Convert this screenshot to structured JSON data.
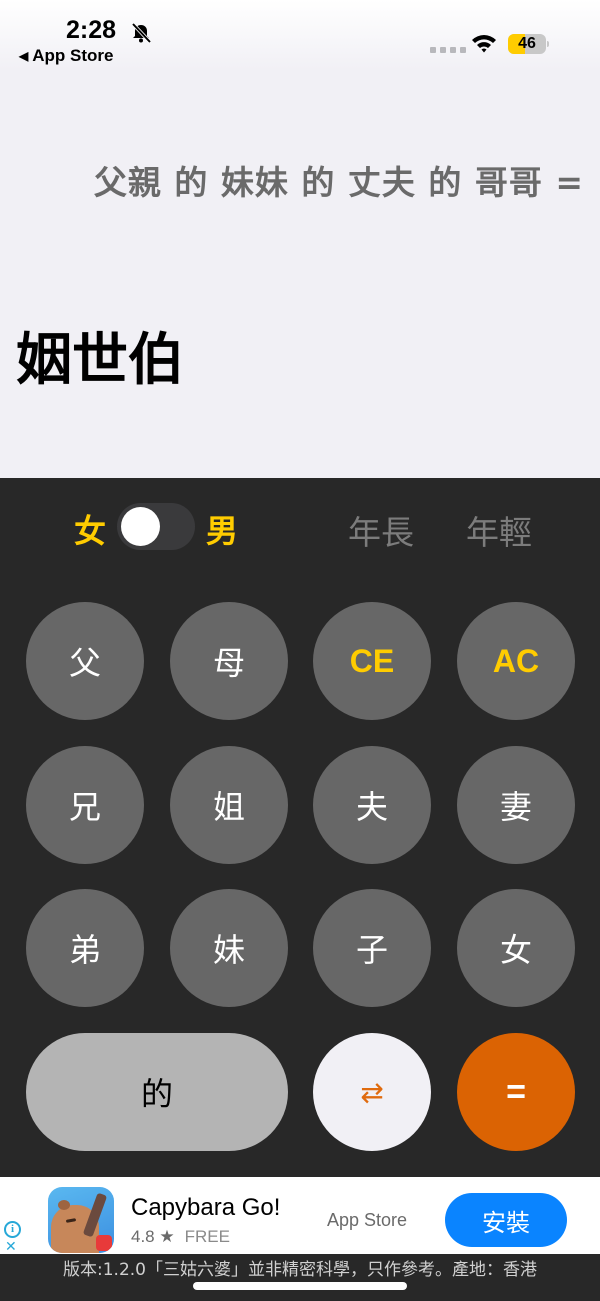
{
  "status_bar": {
    "time": "2:28",
    "back_label": "App Store",
    "battery_level": "46",
    "battery_percent": 46
  },
  "display": {
    "expression": "父親 的 妹妹 的 丈夫 的 哥哥 =",
    "result": "姻世伯"
  },
  "controls": {
    "gender_female": "女",
    "gender_male": "男",
    "age_older": "年長",
    "age_younger": "年輕"
  },
  "keys": {
    "father": "父",
    "mother": "母",
    "ce": "CE",
    "ac": "AC",
    "elder_brother": "兄",
    "elder_sister": "姐",
    "husband": "夫",
    "wife": "妻",
    "younger_brother": "弟",
    "younger_sister": "妹",
    "son": "子",
    "daughter": "女",
    "of": "的",
    "swap": "⇄",
    "equals": "="
  },
  "ad": {
    "title": "Capybara Go!",
    "rating": "4.8 ★",
    "price": "FREE",
    "store": "App Store",
    "install_label": "安裝"
  },
  "footer": {
    "text": "版本:1.2.0「三姑六婆」並非精密科學，只作參考。產地：香港"
  },
  "colors": {
    "accent_gold": "#ffcc00",
    "accent_orange": "#db6303",
    "keypad_bg": "#282828",
    "key_gray": "#676767",
    "install_blue": "#0a84ff"
  }
}
